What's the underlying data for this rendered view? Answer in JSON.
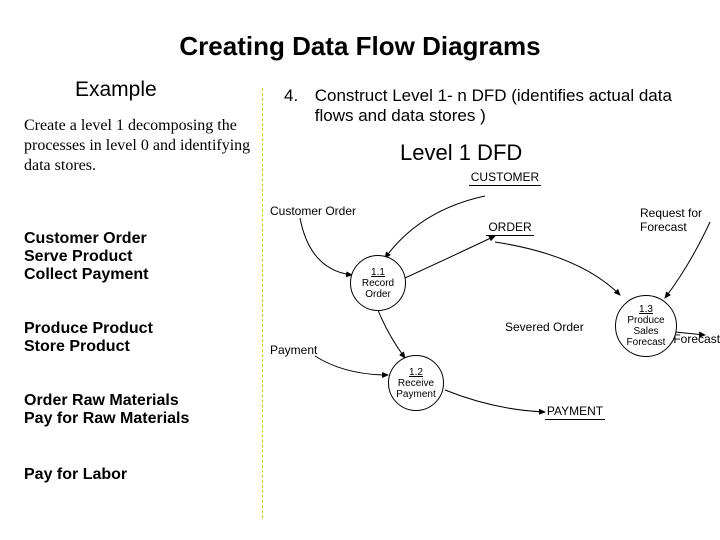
{
  "page_title": "Creating Data Flow Diagrams",
  "example_heading": "Example",
  "example_desc": "Create a level 1 decomposing the processes in level 0 and identifying data stores.",
  "process_blocks": [
    [
      "Customer Order",
      "Serve Product",
      "Collect Payment"
    ],
    [
      "Produce Product",
      "Store Product"
    ],
    [
      "Order Raw Materials",
      "Pay for Raw Materials"
    ],
    [
      "Pay for Labor"
    ]
  ],
  "step": {
    "number": "4.",
    "text": "Construct Level 1- n DFD (identifies actual data flows and data stores )"
  },
  "level1_title": "Level 1 DFD",
  "diagram": {
    "flows": {
      "customer_order": "Customer Order",
      "payment": "Payment",
      "severed_order": "Severed Order",
      "request_for_forecast": "Request for Forecast",
      "sales_forecast": "Sales Forecast"
    },
    "processes": {
      "p11": {
        "id": "1.1",
        "name": "Record Order"
      },
      "p12": {
        "id": "1.2",
        "name": "Receive Payment"
      },
      "p13": {
        "id": "1.3",
        "name": "Produce Sales Forecast"
      }
    },
    "data_stores": {
      "customer": "CUSTOMER",
      "order": "ORDER",
      "payment": "PAYMENT"
    }
  }
}
